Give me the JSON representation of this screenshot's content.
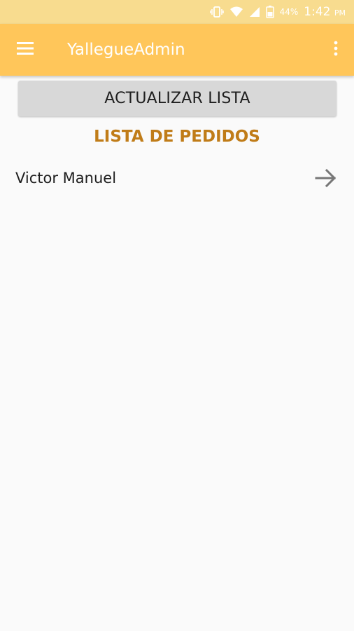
{
  "status_bar": {
    "battery_percent": "44%",
    "time": "1:42",
    "time_suffix": "PM",
    "icons": [
      "vibrate-icon",
      "wifi-icon",
      "signal-icon",
      "battery-icon"
    ]
  },
  "app_bar": {
    "title": "YallegueAdmin",
    "menu_icon": "hamburger-menu-icon",
    "overflow_icon": "more-vert-icon"
  },
  "main": {
    "refresh_button_label": "ACTUALIZAR LISTA",
    "section_title": "LISTA DE PEDIDOS",
    "orders": [
      {
        "name": "Victor Manuel",
        "icon": "arrow-forward-icon"
      }
    ]
  },
  "colors": {
    "status_bar": "#f8dc8f",
    "app_bar": "#ffc65a",
    "accent_title": "#c07c18",
    "button_bg": "#d8d8d8",
    "background": "#fafafa"
  }
}
